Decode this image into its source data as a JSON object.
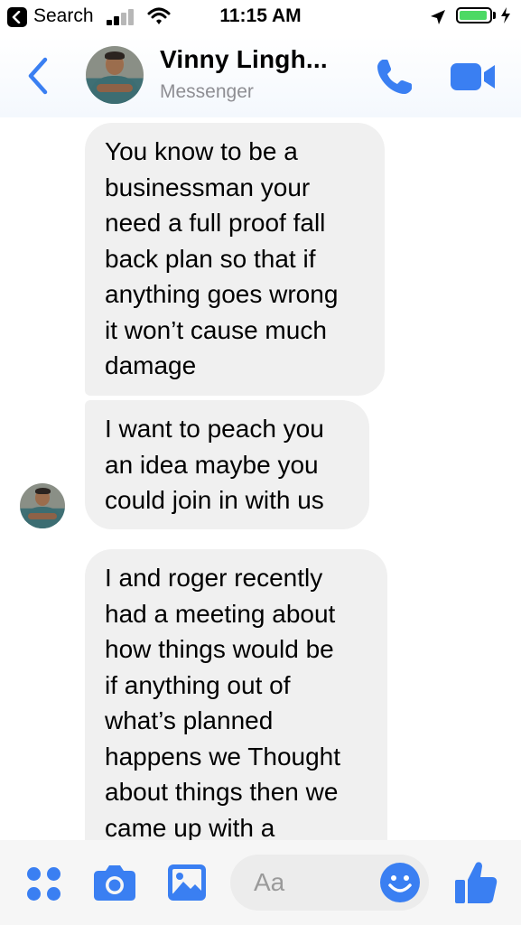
{
  "status_bar": {
    "back_app": "Search",
    "time": "11:15 AM",
    "battery_level": 0.95
  },
  "header": {
    "contact_name": "Vinny Lingh...",
    "subtitle": "Messenger"
  },
  "messages": [
    {
      "text": "You know to be a\nbusinessman your\nneed a full proof fall\nback plan so that if\nanything goes wrong\nit won’t cause much\ndamage"
    },
    {
      "text": "I want to peach you\nan idea maybe you\ncould join in with us"
    },
    {
      "text": "I and roger recently\nhad a meeting about\nhow things would be\nif anything out of\nwhat’s planned\nhappens we Thought\nabout things then we\ncame up with a"
    }
  ],
  "composer": {
    "placeholder": "Aa"
  },
  "colors": {
    "accent": "#3a7ff2",
    "bubble": "#f0f0f0",
    "subtitle": "#8e8e93"
  },
  "icons": [
    "back-chevron-icon",
    "phone-icon",
    "video-camera-icon",
    "apps-grid-icon",
    "camera-icon",
    "image-icon",
    "emoji-icon",
    "thumbs-up-icon"
  ]
}
